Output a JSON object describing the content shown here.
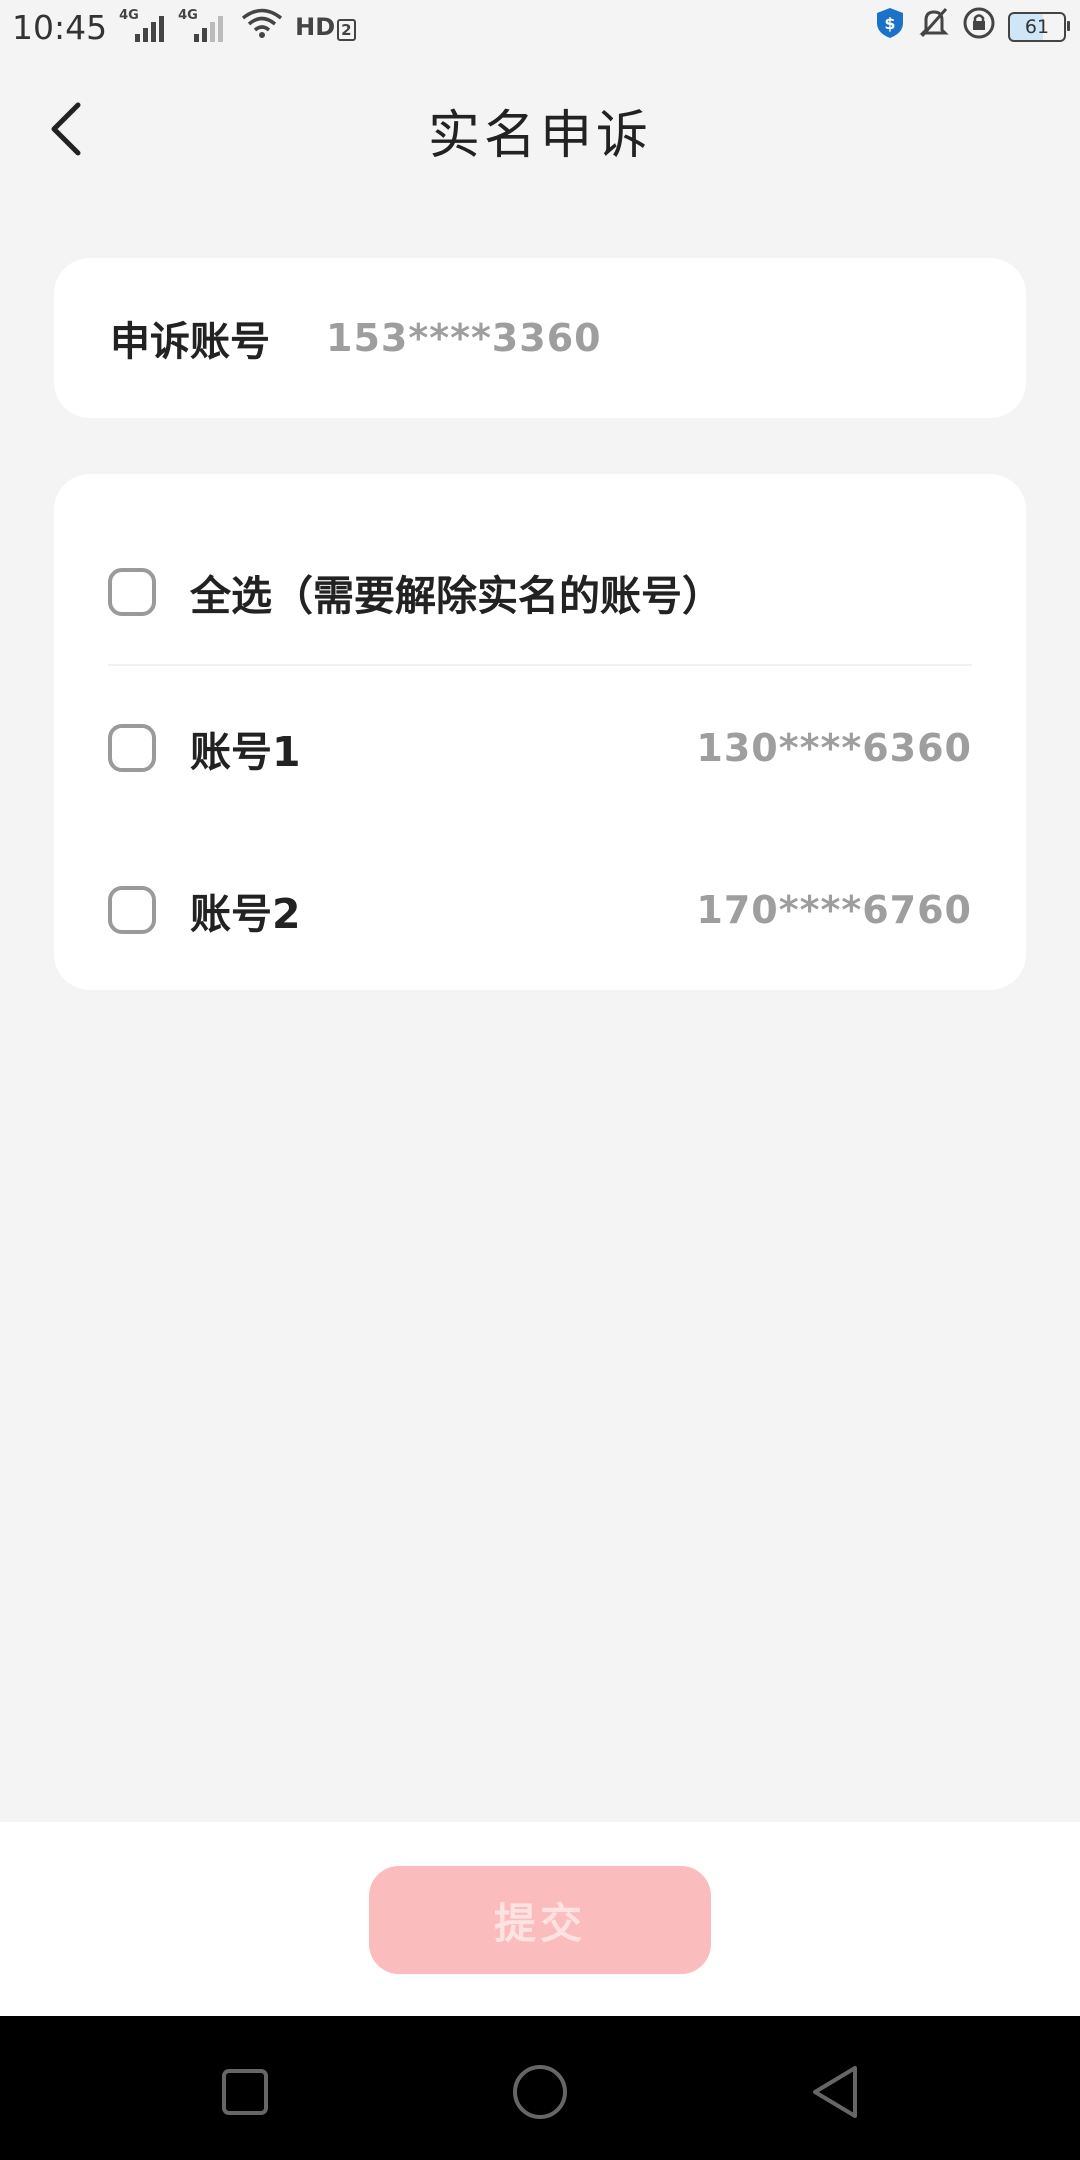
{
  "status_bar": {
    "time": "10:45",
    "network1": "4G",
    "network2": "4G",
    "hd_label": "HD",
    "hd_sub": "2",
    "battery": "61"
  },
  "nav": {
    "title": "实名申诉"
  },
  "account": {
    "label": "申诉账号",
    "value": "153****3360"
  },
  "selection": {
    "select_all_label": "全选（需要解除实名的账号）",
    "items": [
      {
        "label": "账号1",
        "value": "130****6360"
      },
      {
        "label": "账号2",
        "value": "170****6760"
      }
    ]
  },
  "submit": {
    "label": "提交"
  },
  "colors": {
    "background": "#f4f4f4",
    "card": "#ffffff",
    "submit_disabled": "#fbbcbd",
    "muted_text": "#9e9e9e"
  }
}
